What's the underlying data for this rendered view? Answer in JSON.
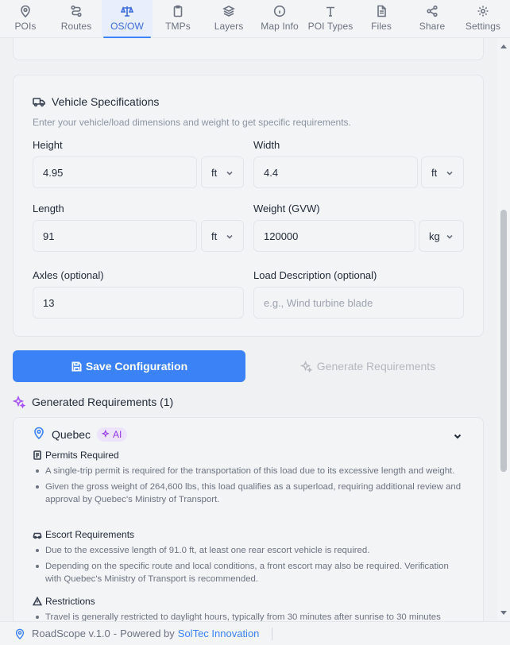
{
  "nav": {
    "tabs": [
      {
        "label": "POIs",
        "icon": "pin-icon"
      },
      {
        "label": "Routes",
        "icon": "route-icon"
      },
      {
        "label": "OS/OW",
        "icon": "scale-icon",
        "active": true
      },
      {
        "label": "TMPs",
        "icon": "clipboard-icon"
      },
      {
        "label": "Layers",
        "icon": "layers-icon"
      },
      {
        "label": "Map Info",
        "icon": "info-icon"
      },
      {
        "label": "POI Types",
        "icon": "type-icon"
      },
      {
        "label": "Files",
        "icon": "file-icon"
      },
      {
        "label": "Share",
        "icon": "share-icon"
      },
      {
        "label": "Settings",
        "icon": "gear-icon"
      }
    ]
  },
  "vehicle": {
    "title": "Vehicle Specifications",
    "subtitle": "Enter your vehicle/load dimensions and weight to get specific requirements.",
    "height": {
      "label": "Height",
      "value": "4.95",
      "unit": "ft"
    },
    "width": {
      "label": "Width",
      "value": "4.4",
      "unit": "ft"
    },
    "length": {
      "label": "Length",
      "value": "91",
      "unit": "ft"
    },
    "weight": {
      "label": "Weight (GVW)",
      "value": "120000",
      "unit": "kg"
    },
    "axles": {
      "label": "Axles (optional)",
      "value": "13"
    },
    "load": {
      "label": "Load Description (optional)",
      "placeholder": "e.g., Wind turbine blade"
    }
  },
  "actions": {
    "save": "Save Configuration",
    "generate": "Generate Requirements"
  },
  "generated": {
    "title": "Generated Requirements (1)",
    "region": "Quebec",
    "badge": "AI",
    "sections": [
      {
        "title": "Permits Required",
        "items": [
          "A single-trip permit is required for the transportation of this load due to its excessive length and weight.",
          "Given the gross weight of 264,600 lbs, this load qualifies as a superload, requiring additional review and approval by Quebec's Ministry of Transport."
        ]
      },
      {
        "title": "Escort Requirements",
        "items": [
          "Due to the excessive length of 91.0 ft, at least one rear escort vehicle is required.",
          "Depending on the specific route and local conditions, a front escort may also be required. Verification with Quebec's Ministry of Transport is recommended."
        ]
      },
      {
        "title": "Restrictions",
        "items": [
          "Travel is generally restricted to daylight hours, typically from 30 minutes after sunrise to 30 minutes"
        ]
      }
    ]
  },
  "footer": {
    "app": "RoadScope v.1.0",
    "powered": "Powered by",
    "brand": "SolTec Innovation"
  }
}
